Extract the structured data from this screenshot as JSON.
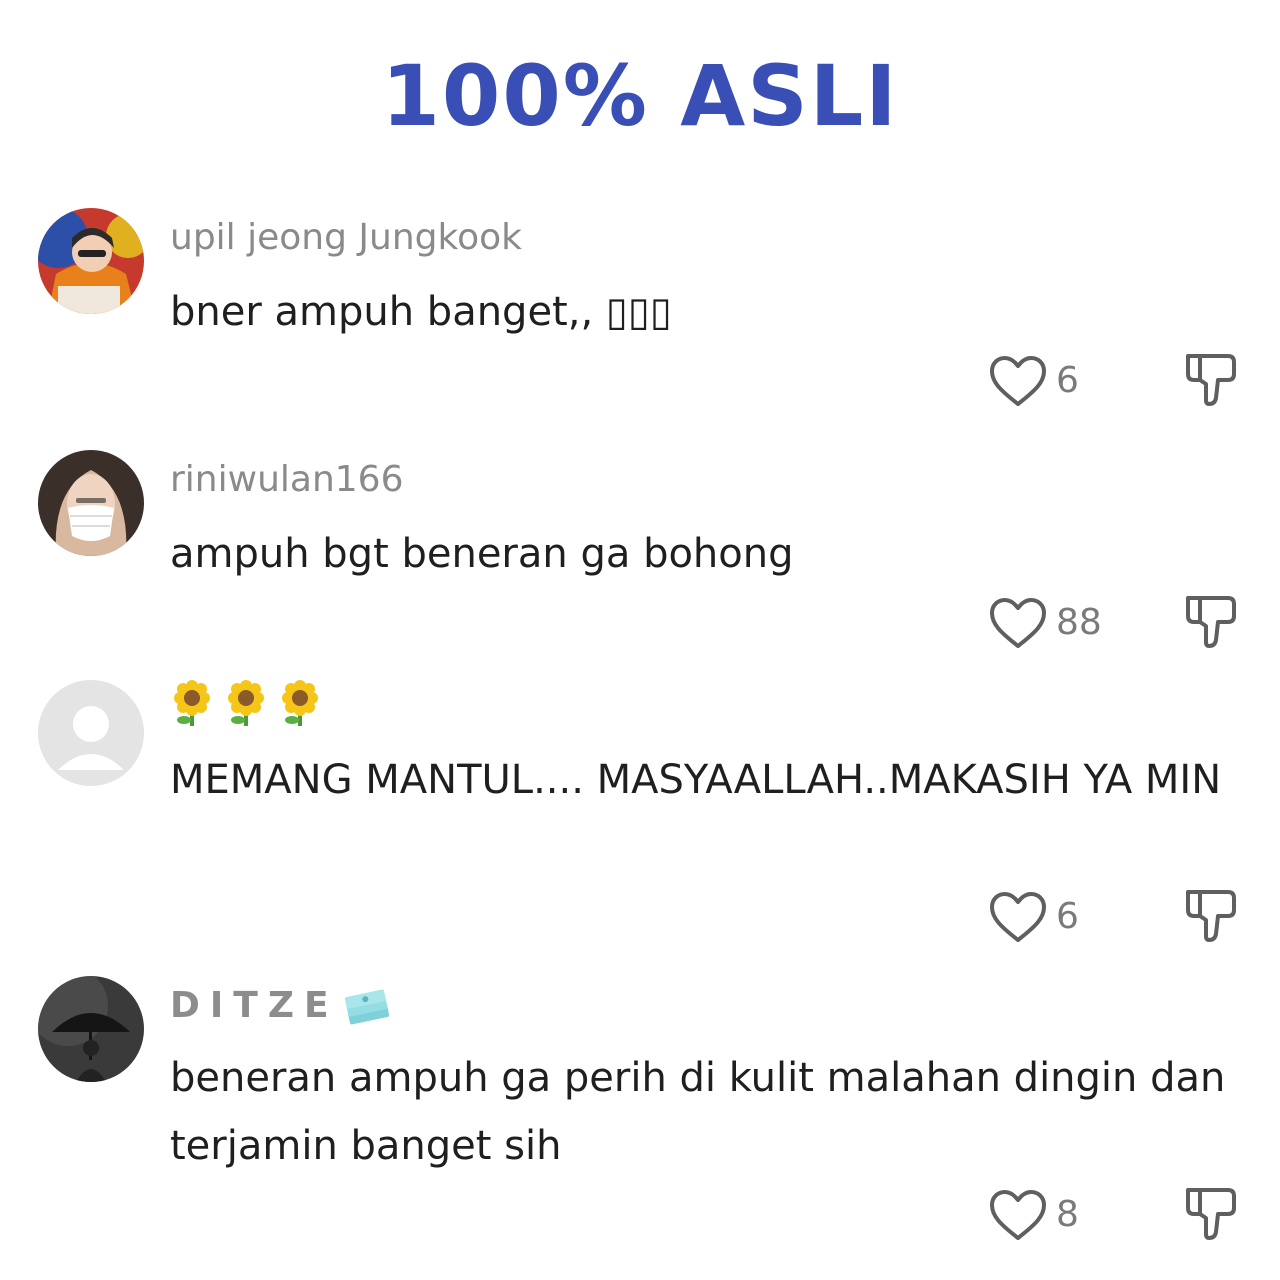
{
  "headline": {
    "text": "100% ASLI",
    "color": "#3a4fb5"
  },
  "comments": [
    {
      "username": "upil jeong Jungkook",
      "text": "bner ampuh banget,, ▯▯▯",
      "likes": "6",
      "avatar_icon": "avatar-orange-portrait"
    },
    {
      "username": "riniwulan166",
      "text": "ampuh bgt beneran ga bohong",
      "likes": "88",
      "avatar_icon": "avatar-hijab-mask"
    },
    {
      "username_icons": [
        "sunflower-emoji",
        "sunflower-emoji",
        "sunflower-emoji"
      ],
      "text": "MEMANG MANTUL.... MASYAALLAH..MAKASIH YA MIN",
      "likes": "6",
      "avatar_icon": "default-avatar"
    },
    {
      "username": "DITZE",
      "username_badge": "money-stack-emoji",
      "text": "beneran ampuh ga perih di kulit malahan dingin dan terjamin banget sih",
      "likes": "8",
      "avatar_icon": "avatar-umbrella-dark"
    }
  ]
}
